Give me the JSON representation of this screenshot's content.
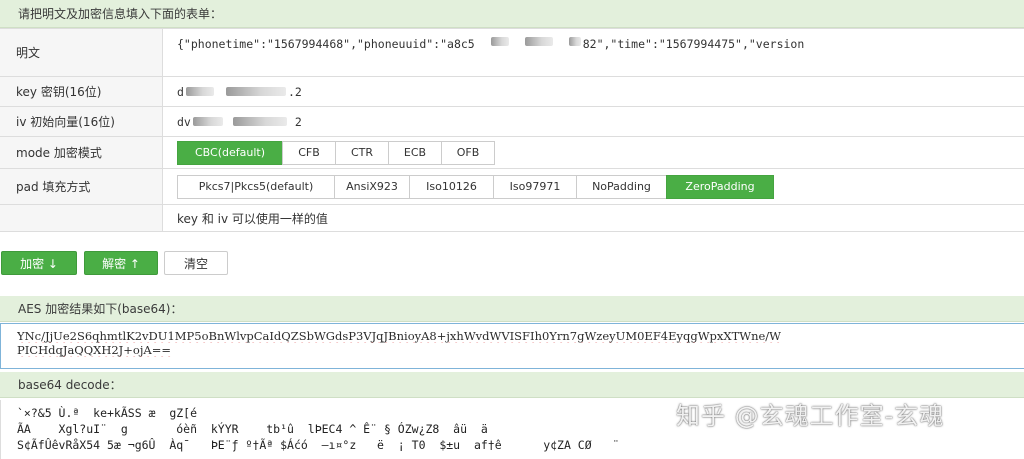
{
  "form_header": "请把明文及加密信息填入下面的表单：",
  "rows": {
    "plaintext": {
      "label": "明文",
      "value_start": "{\"phonetime\":\"1567994468\",\"phoneuuid\":\"a8c5",
      "value_end": "82\",\"time\":\"1567994475\",\"version"
    },
    "key": {
      "label": "key 密钥(16位)",
      "value_start": "d",
      "value_end": ".2"
    },
    "iv": {
      "label": "iv 初始向量(16位)",
      "value_start": "dv",
      "value_end": "2"
    },
    "mode": {
      "label": "mode 加密模式",
      "options": [
        "CBC(default)",
        "CFB",
        "CTR",
        "ECB",
        "OFB"
      ],
      "selected": "CBC(default)"
    },
    "pad": {
      "label": "pad 填充方式",
      "options": [
        "Pkcs7|Pkcs5(default)",
        "AnsiX923",
        "Iso10126",
        "Iso97971",
        "NoPadding",
        "ZeroPadding"
      ],
      "selected": "ZeroPadding"
    },
    "note": {
      "label": "",
      "text": "key 和 iv 可以使用一样的值"
    }
  },
  "buttons": {
    "encrypt": "加密 ↓",
    "decrypt": "解密 ↑",
    "clear": "清空"
  },
  "result_header": "AES 加密结果如下(base64)：",
  "result": {
    "line1": "YNc/JjUe2S6qhmtlK2vDU1MP5oBnWlvpCaIdQZSbWGdsP3VJqJBnioyA8+jxhWvdWVISFIh0Yrn7gWzeyUM0EF4EyqgWpxXTWne/W",
    "line2": "PICHdqJaQQXH2J+ojA=="
  },
  "decode_header": "base64 decode：",
  "decode": {
    "line1": "`×?&5 Ù.ª  ke+kÃSS æ  gZ[é",
    "line2": "ÃA    Xgl?uI¨  g       óèñ  kÝYR    tb¹û  lÞEC4 ^ Ê¨ § ÓZw¿Z8  âü  ä",
    "line3": "S¢ÃfÛêvRåX54 5æ ¬g6Û  Àq¯   ÞE¨ƒ º†Ãª $Áćó  —ı¤°z   ë  ¡ T0  $±u  af†ê      y¢ZA CØ   ¨"
  },
  "watermark": "知乎 @玄魂工作室-玄魂",
  "colors": {
    "accent": "#4aae45",
    "header_bg": "#e3f0dc",
    "output_border": "#7fb4d9"
  }
}
